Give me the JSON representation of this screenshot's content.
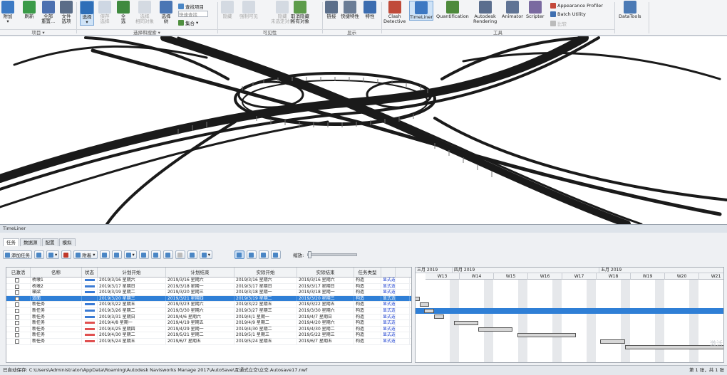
{
  "ribbon": {
    "buttons": [
      {
        "label": "附加",
        "sub": "▾",
        "color": "#3c7ac4"
      },
      {
        "label": "刷新",
        "sub": "",
        "color": "#3a9a48"
      },
      {
        "label": "全部",
        "sub": "重置...",
        "color": "#4c70b0"
      },
      {
        "label": "文件",
        "sub": "选项",
        "color": "#5b6d88"
      },
      {
        "label": "选择",
        "sub": "▾",
        "color": "#2f6fb8"
      },
      {
        "label": "保存",
        "sub": "选择",
        "color": "#8aa0c0"
      },
      {
        "label": "全",
        "sub": "选",
        "color": "#3f8a3f"
      },
      {
        "label": "选择",
        "sub": "相同对象",
        "color": "#9aa8bd"
      },
      {
        "label": "选择",
        "sub": "树",
        "color": "#4a76b4"
      },
      {
        "label": "隐藏",
        "sub": "",
        "color": "#9aa8bd"
      },
      {
        "label": "强制可见",
        "sub": "",
        "color": "#9aa8bd"
      },
      {
        "label": "隐藏",
        "sub": "未选定对象",
        "color": "#9aa8bd"
      },
      {
        "label": "取消隐藏",
        "sub": "所有对象",
        "color": "#5d9c4b"
      },
      {
        "label": "链接",
        "sub": "",
        "color": "#5c6f8a"
      },
      {
        "label": "快捷特性",
        "sub": "",
        "color": "#6b7d96"
      },
      {
        "label": "特性",
        "sub": "",
        "color": "#3c6db0"
      },
      {
        "label": "Clash",
        "sub": "Detective",
        "color": "#c04b3a"
      },
      {
        "label": "TimeLiner",
        "sub": "",
        "color": "#3d78c2"
      },
      {
        "label": "Quantification",
        "sub": "",
        "color": "#4e8a3c"
      },
      {
        "label": "Autodesk",
        "sub": "Rendering",
        "color": "#5b6e8e"
      },
      {
        "label": "Animator",
        "sub": "",
        "color": "#5f7394"
      },
      {
        "label": "Scripter",
        "sub": "",
        "color": "#7a6aa0"
      },
      {
        "label": "DataTools",
        "sub": "",
        "color": "#4b7ab5"
      }
    ],
    "small_items": {
      "find": "查找项目",
      "quick_find": "快速查找",
      "sets": "集合",
      "appearance": "Appearance Profiler",
      "batch": "Batch Utility",
      "compare": "比较"
    },
    "groups": [
      "项目 ▾",
      "选择和搜索 ▾",
      "可见性",
      "显示",
      "工具"
    ]
  },
  "timeliner": {
    "title": "TimeLiner",
    "tabs": [
      "任务",
      "数据源",
      "配置",
      "模拟"
    ],
    "toolbar": {
      "add_task": "添加任务",
      "attach": "附着",
      "zoom_label": "缩放:"
    },
    "columns": [
      "已激活",
      "名称",
      "状态",
      "计划开始",
      "计划结束",
      "实际开始",
      "实际结束",
      "任务类型",
      ""
    ],
    "rows": [
      {
        "name": "桥墩1",
        "ps": "2019/3/16 星期六",
        "pe": "2019/3/16 星期六",
        "as": "2019/3/16 星期六",
        "ae": "2019/3/16 星期六",
        "type": "构造",
        "att": "显式选择",
        "color": "#3a7bd5"
      },
      {
        "name": "桥墩2",
        "ps": "2019/3/17 星期日",
        "pe": "2019/3/18 星期一",
        "as": "2019/3/17 星期日",
        "ae": "2019/3/17 星期日",
        "type": "构造",
        "att": "显式选择",
        "color": "#3a7bd5"
      },
      {
        "name": "箱梁",
        "ps": "2019/3/19 星期二",
        "pe": "2019/3/20 星期三",
        "as": "2019/3/18 星期一",
        "ae": "2019/3/18 星期一",
        "type": "构造",
        "att": "显式选择",
        "color": "#3a7bd5"
      },
      {
        "name": "道面",
        "ps": "2019/3/20 星期三",
        "pe": "2019/3/21 星期四",
        "as": "2019/3/19 星期二",
        "ae": "2019/3/20 星期三",
        "type": "构造",
        "att": "显式选择",
        "color": "#3a7bd5"
      },
      {
        "name": "新任务",
        "ps": "2019/3/22 星期五",
        "pe": "2019/3/23 星期六",
        "as": "2019/3/22 星期五",
        "ae": "2019/3/22 星期五",
        "type": "构造",
        "att": "显式选择",
        "color": "#3a7bd5"
      },
      {
        "name": "新任务",
        "ps": "2019/3/26 星期二",
        "pe": "2019/3/30 星期六",
        "as": "2019/3/27 星期三",
        "ae": "2019/3/30 星期六",
        "type": "构造",
        "att": "显式选择",
        "color": "#3a7bd5"
      },
      {
        "name": "新任务",
        "ps": "2019/3/31 星期日",
        "pe": "2019/4/6 星期六",
        "as": "2019/4/1 星期一",
        "ae": "2019/4/7 星期日",
        "type": "构造",
        "att": "显式选择",
        "color": "#3a7bd5"
      },
      {
        "name": "新任务",
        "ps": "2019/4/8 星期一",
        "pe": "2019/4/19 星期五",
        "as": "2019/4/9 星期二",
        "ae": "2019/4/20 星期六",
        "type": "构造",
        "att": "显式选择",
        "color": "#e05050"
      },
      {
        "name": "新任务",
        "ps": "2019/4/25 星期四",
        "pe": "2019/4/29 星期一",
        "as": "2019/4/30 星期二",
        "ae": "2019/4/30 星期二",
        "type": "构造",
        "att": "显式选择",
        "color": "#e05050"
      },
      {
        "name": "新任务",
        "ps": "2019/4/30 星期二",
        "pe": "2019/5/21 星期二",
        "as": "2019/5/1 星期三",
        "ae": "2019/5/22 星期三",
        "type": "构造",
        "att": "显式选择",
        "color": "#e05050"
      },
      {
        "name": "新任务",
        "ps": "2019/5/24 星期五",
        "pe": "2019/6/7 星期五",
        "as": "2019/5/24 星期五",
        "ae": "2019/6/7 星期五",
        "type": "构造",
        "att": "显式选择",
        "color": "#e05050"
      }
    ],
    "selected_row": 3,
    "months": [
      "三月 2019",
      "四月 2019",
      "五月 2019"
    ],
    "weeks": [
      "W13",
      "W14",
      "W15",
      "W16",
      "W17",
      "W18",
      "W19",
      "W20",
      "W21"
    ]
  },
  "status": {
    "left": "已自动保存: C:\\Users\\Administrator\\AppData\\Roaming\\Autodesk Navisworks Manage 2017\\AutoSave\\互通式立交\\立交.Autosave17.nwf",
    "right": "第 1 张，共 1 张"
  },
  "watermark": "激活"
}
